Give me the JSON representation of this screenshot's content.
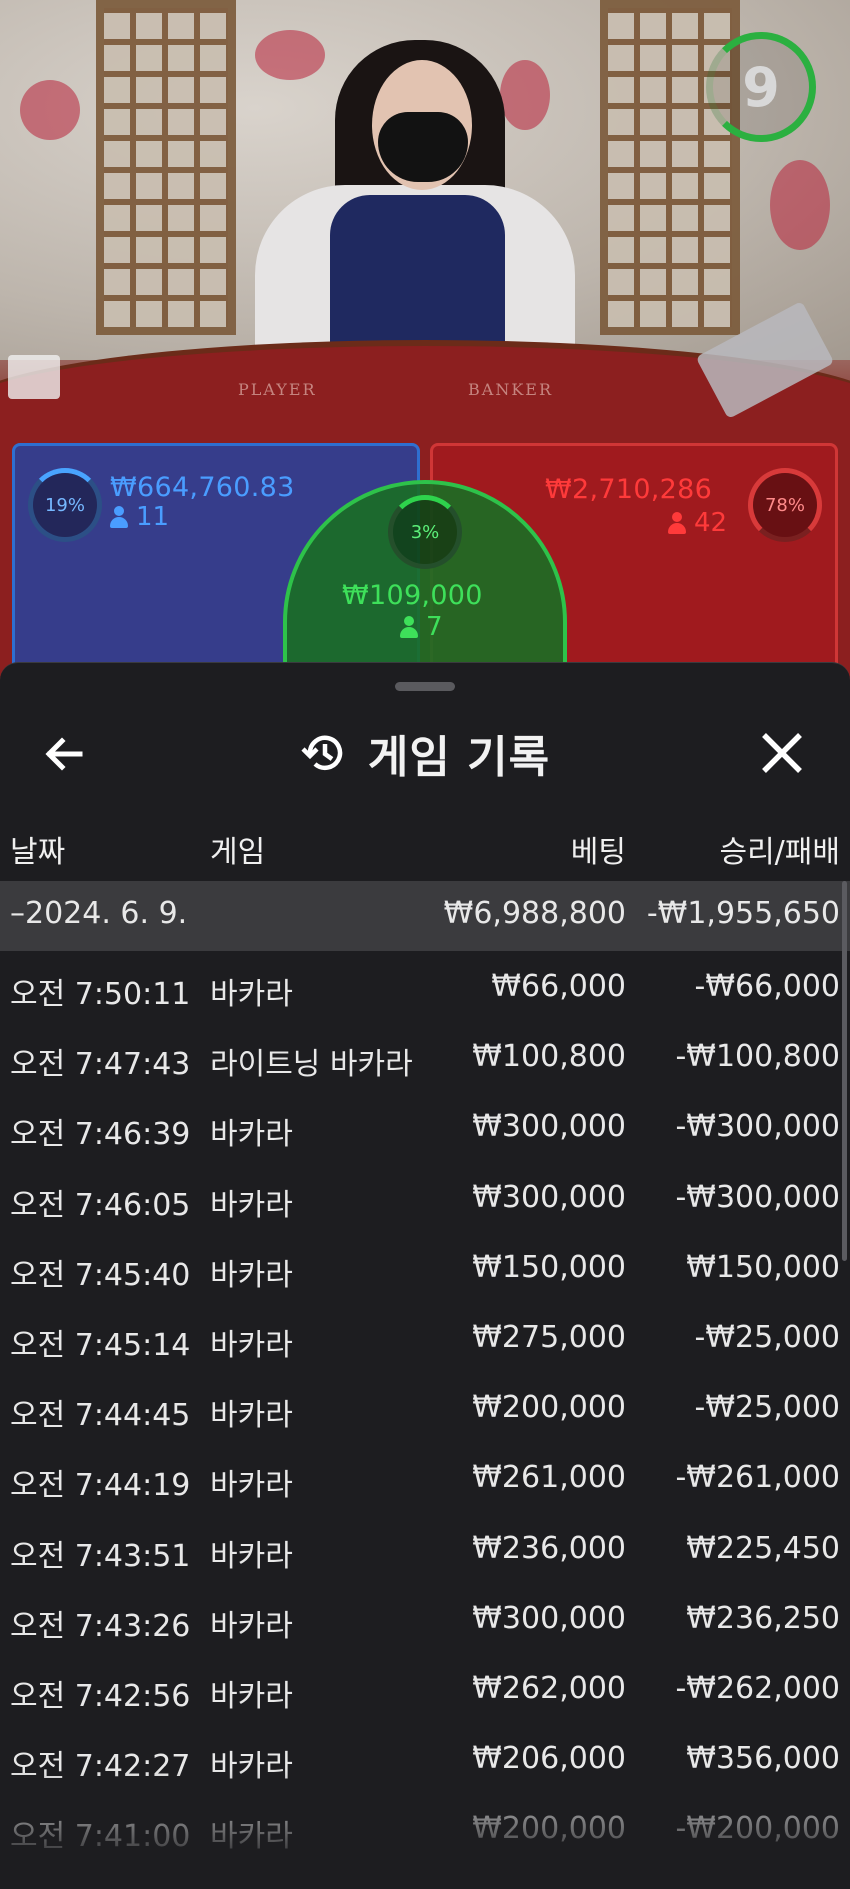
{
  "video": {
    "timer": "9",
    "table_labels": {
      "player": "PLAYER",
      "banker": "BANKER"
    },
    "player": {
      "percent": "19%",
      "amount": "₩664,760.83",
      "count": "11"
    },
    "tie": {
      "percent": "3%",
      "amount": "₩109,000",
      "count": "7"
    },
    "banker": {
      "percent": "78%",
      "amount": "₩2,710,286",
      "count": "42"
    },
    "colors": {
      "player": "#2f6fd0",
      "banker": "#d03636",
      "tie": "#2ec24a"
    }
  },
  "history": {
    "title": "게임 기록",
    "icons": {
      "back": "arrow-left-icon",
      "title": "history-icon",
      "close": "close-icon"
    },
    "columns": {
      "date": "날짜",
      "game": "게임",
      "bet": "베팅",
      "result": "승리/패배"
    },
    "date_group": {
      "label": "–2024. 6. 9.",
      "bet": "₩6,988,800",
      "result": "-₩1,955,650"
    },
    "rows": [
      {
        "time": "오전 7:50:11",
        "game": "바카라",
        "bet": "₩66,000",
        "result": "-₩66,000"
      },
      {
        "time": "오전 7:47:43",
        "game": "라이트닝 바카라",
        "bet": "₩100,800",
        "result": "-₩100,800"
      },
      {
        "time": "오전 7:46:39",
        "game": "바카라",
        "bet": "₩300,000",
        "result": "-₩300,000"
      },
      {
        "time": "오전 7:46:05",
        "game": "바카라",
        "bet": "₩300,000",
        "result": "-₩300,000"
      },
      {
        "time": "오전 7:45:40",
        "game": "바카라",
        "bet": "₩150,000",
        "result": "₩150,000"
      },
      {
        "time": "오전 7:45:14",
        "game": "바카라",
        "bet": "₩275,000",
        "result": "-₩25,000"
      },
      {
        "time": "오전 7:44:45",
        "game": "바카라",
        "bet": "₩200,000",
        "result": "-₩25,000"
      },
      {
        "time": "오전 7:44:19",
        "game": "바카라",
        "bet": "₩261,000",
        "result": "-₩261,000"
      },
      {
        "time": "오전 7:43:51",
        "game": "바카라",
        "bet": "₩236,000",
        "result": "₩225,450"
      },
      {
        "time": "오전 7:43:26",
        "game": "바카라",
        "bet": "₩300,000",
        "result": "₩236,250"
      },
      {
        "time": "오전 7:42:56",
        "game": "바카라",
        "bet": "₩262,000",
        "result": "-₩262,000"
      },
      {
        "time": "오전 7:42:27",
        "game": "바카라",
        "bet": "₩206,000",
        "result": "₩356,000"
      },
      {
        "time": "오전 7:41:00",
        "game": "바카라",
        "bet": "₩200,000",
        "result": "-₩200,000"
      }
    ]
  }
}
